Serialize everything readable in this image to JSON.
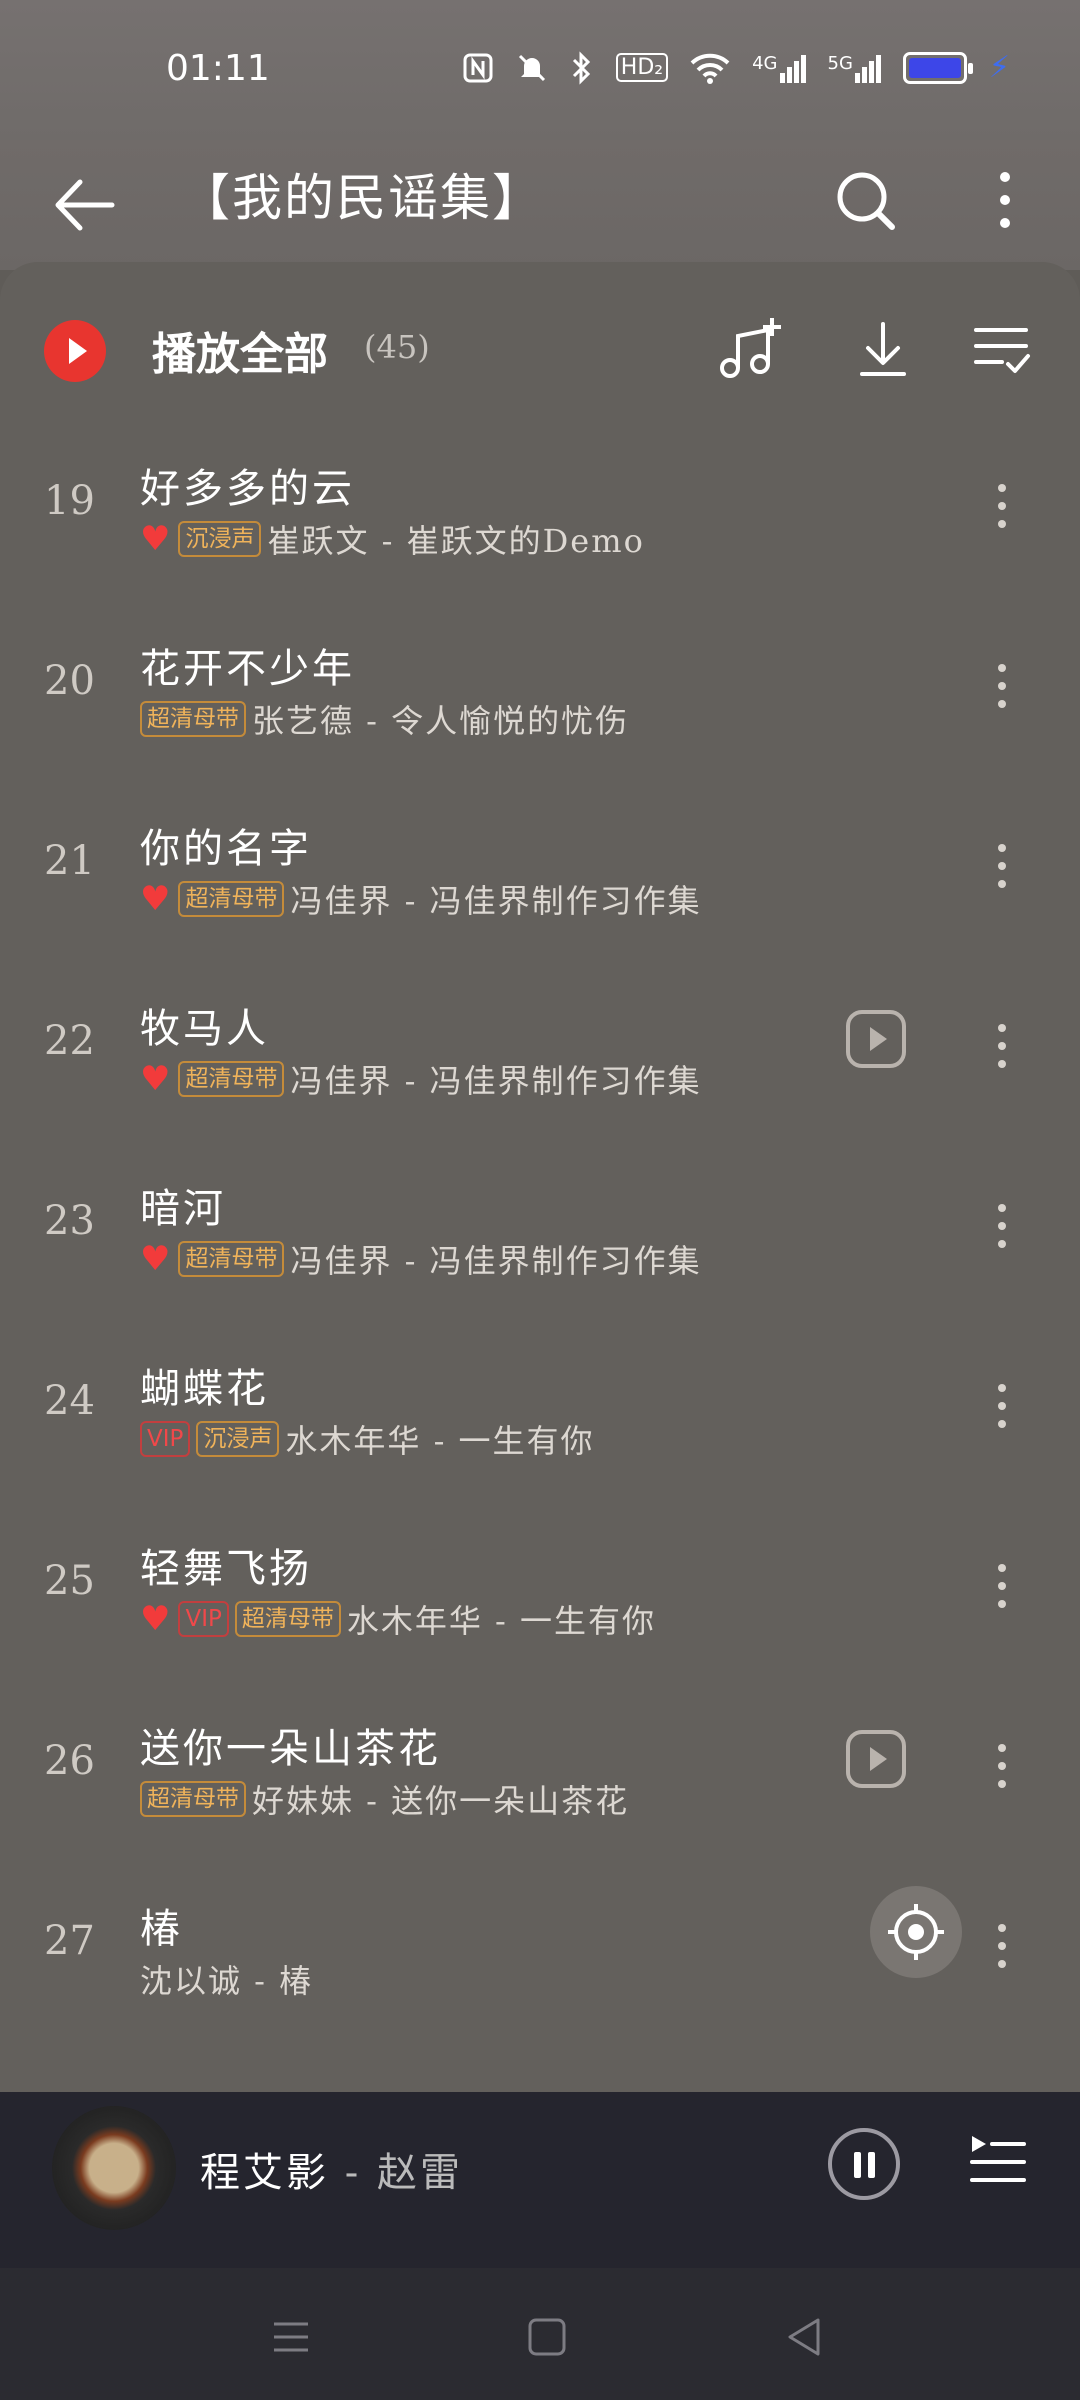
{
  "status_bar": {
    "time": "01:11",
    "icons": [
      "nfc-icon",
      "mute-icon",
      "bluetooth-icon",
      "hd-icon",
      "wifi-icon",
      "signal-4g-icon",
      "signal-5g-icon",
      "battery-icon",
      "charging-icon"
    ],
    "hd_label": "HD₂",
    "net1": "4G",
    "net2": "5G"
  },
  "header": {
    "title": "【我的民谣集】"
  },
  "play_all": {
    "label": "播放全部",
    "count": "(45)"
  },
  "songs": [
    {
      "num": "19",
      "title": "好多多的云",
      "liked": true,
      "tags": [
        "沉浸声"
      ],
      "meta": "崔跃文 - 崔跃文的Demo",
      "has_video": false
    },
    {
      "num": "20",
      "title": "花开不少年",
      "liked": false,
      "tags": [
        "超清母带"
      ],
      "meta": "张艺德 - 令人愉悦的忧伤",
      "has_video": false
    },
    {
      "num": "21",
      "title": "你的名字",
      "liked": true,
      "tags": [
        "超清母带"
      ],
      "meta": "冯佳界 - 冯佳界制作习作集",
      "has_video": false
    },
    {
      "num": "22",
      "title": "牧马人",
      "liked": true,
      "tags": [
        "超清母带"
      ],
      "meta": "冯佳界 - 冯佳界制作习作集",
      "has_video": true
    },
    {
      "num": "23",
      "title": "暗河",
      "liked": true,
      "tags": [
        "超清母带"
      ],
      "meta": "冯佳界 - 冯佳界制作习作集",
      "has_video": false
    },
    {
      "num": "24",
      "title": "蝴蝶花",
      "liked": false,
      "tags": [
        "VIP",
        "沉浸声"
      ],
      "meta": "水木年华 - 一生有你",
      "has_video": false
    },
    {
      "num": "25",
      "title": "轻舞飞扬",
      "liked": true,
      "tags": [
        "VIP",
        "超清母带"
      ],
      "meta": "水木年华 - 一生有你",
      "has_video": false
    },
    {
      "num": "26",
      "title": "送你一朵山茶花",
      "liked": false,
      "tags": [
        "超清母带"
      ],
      "meta": "好妹妹 - 送你一朵山茶花",
      "has_video": true
    },
    {
      "num": "27",
      "title": "椿",
      "liked": false,
      "tags": [],
      "meta": "沈以诚 - 椿",
      "has_video": false
    }
  ],
  "player": {
    "song": "程艾影",
    "separator": " - ",
    "artist": "赵雷"
  },
  "colors": {
    "accent_red": "#e8352f",
    "tag_orange": "#f0b35a",
    "tag_red": "#f0484a",
    "heart": "#f23b3b"
  }
}
